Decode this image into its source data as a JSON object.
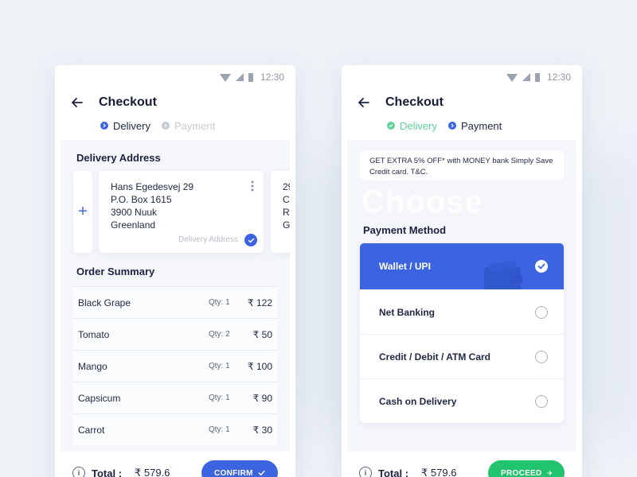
{
  "colors": {
    "accent": "#3c64e0",
    "success": "#21c36f",
    "step_done": "#5fd39a",
    "background": "#eef2f7"
  },
  "status_bar": {
    "time": "12:30"
  },
  "left": {
    "title": "Checkout",
    "steps": [
      {
        "label": "Delivery"
      },
      {
        "label": "Payment"
      }
    ],
    "delivery_address_title": "Delivery Address",
    "address_card": {
      "lines": [
        "Hans Egedesvej 29",
        "P.O. Box 1615",
        "3900 Nuuk",
        "Greenland"
      ],
      "tag": "Delivery Address"
    },
    "peek_card": {
      "lines": [
        "29",
        "C",
        "R",
        "G"
      ]
    },
    "order_summary_title": "Order Summary",
    "orders": [
      {
        "name": "Black Grape",
        "qty": "Qty: 1",
        "price": "₹ 122"
      },
      {
        "name": "Tomato",
        "qty": "Qty: 2",
        "price": "₹ 50"
      },
      {
        "name": "Mango",
        "qty": "Qty: 1",
        "price": "₹ 100"
      },
      {
        "name": "Capsicum",
        "qty": "Qty: 1",
        "price": "₹ 90"
      },
      {
        "name": "Carrot",
        "qty": "Qty: 1",
        "price": "₹ 30"
      }
    ],
    "total_label": "Total :",
    "total_value": "₹ 579.6",
    "confirm_label": "CONFIRM"
  },
  "right": {
    "title": "Checkout",
    "steps": [
      {
        "label": "Delivery"
      },
      {
        "label": "Payment"
      }
    ],
    "promo_text": "GET EXTRA 5% OFF* with MONEY bank Simply Save Credit card.    T&C.",
    "watermark": "Choose",
    "payment_method_title": "Payment Method",
    "payment_options": [
      {
        "label": "Wallet / UPI"
      },
      {
        "label": "Net Banking"
      },
      {
        "label": "Credit / Debit / ATM Card"
      },
      {
        "label": "Cash on Delivery"
      }
    ],
    "total_label": "Total :",
    "total_value": "₹ 579.6",
    "proceed_label": "PROCEED"
  }
}
